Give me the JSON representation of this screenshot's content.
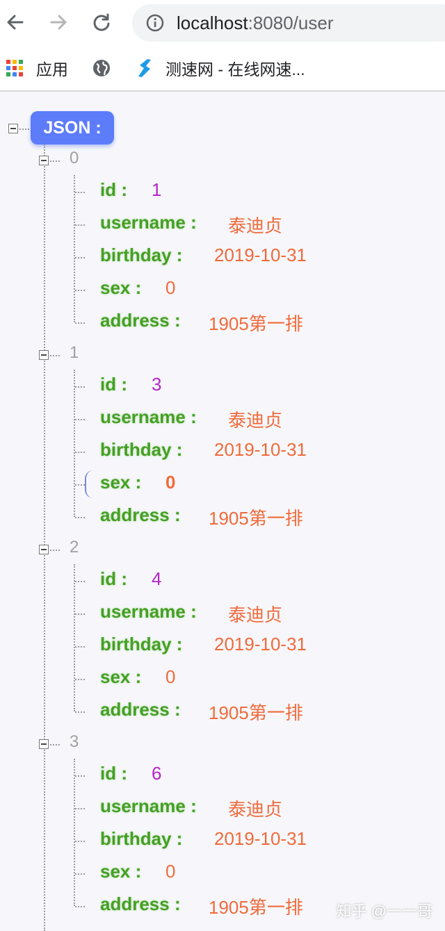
{
  "browser": {
    "url_host": "localhost",
    "url_rest": ":8080/user",
    "bookmarks": [
      {
        "label": "应用",
        "icon": "apps-grid-icon"
      },
      {
        "label": "",
        "icon": "globe-icon"
      },
      {
        "label": "测速网 - 在线网速...",
        "icon": "speedtest-icon"
      }
    ]
  },
  "json_viewer": {
    "root_label": "JSON :",
    "items": [
      {
        "index": "0",
        "fields": [
          {
            "key": "id :",
            "value": "1",
            "type": "num"
          },
          {
            "key": "username :",
            "value": "泰迪贞",
            "type": "str"
          },
          {
            "key": "birthday :",
            "value": "2019-10-31",
            "type": "str"
          },
          {
            "key": "sex :",
            "value": "0",
            "type": "sex"
          },
          {
            "key": "address :",
            "value": "1905第一排",
            "type": "str"
          }
        ]
      },
      {
        "index": "1",
        "fields": [
          {
            "key": "id :",
            "value": "3",
            "type": "num"
          },
          {
            "key": "username :",
            "value": "泰迪贞",
            "type": "str"
          },
          {
            "key": "birthday :",
            "value": "2019-10-31",
            "type": "str"
          },
          {
            "key": "sex :",
            "value": "0",
            "type": "sex"
          },
          {
            "key": "address :",
            "value": "1905第一排",
            "type": "str"
          }
        ]
      },
      {
        "index": "2",
        "fields": [
          {
            "key": "id :",
            "value": "4",
            "type": "num"
          },
          {
            "key": "username :",
            "value": "泰迪贞",
            "type": "str"
          },
          {
            "key": "birthday :",
            "value": "2019-10-31",
            "type": "str"
          },
          {
            "key": "sex :",
            "value": "0",
            "type": "sex"
          },
          {
            "key": "address :",
            "value": "1905第一排",
            "type": "str"
          }
        ]
      },
      {
        "index": "3",
        "fields": [
          {
            "key": "id :",
            "value": "6",
            "type": "num"
          },
          {
            "key": "username :",
            "value": "泰迪贞",
            "type": "str"
          },
          {
            "key": "birthday :",
            "value": "2019-10-31",
            "type": "str"
          },
          {
            "key": "sex :",
            "value": "0",
            "type": "sex"
          },
          {
            "key": "address :",
            "value": "1905第一排",
            "type": "str"
          }
        ]
      }
    ]
  },
  "watermark": "知乎 @一一哥",
  "colors": {
    "key": "#44a024",
    "number": "#b524c9",
    "string": "#f06a3a",
    "badge": "#5c7cfa"
  }
}
